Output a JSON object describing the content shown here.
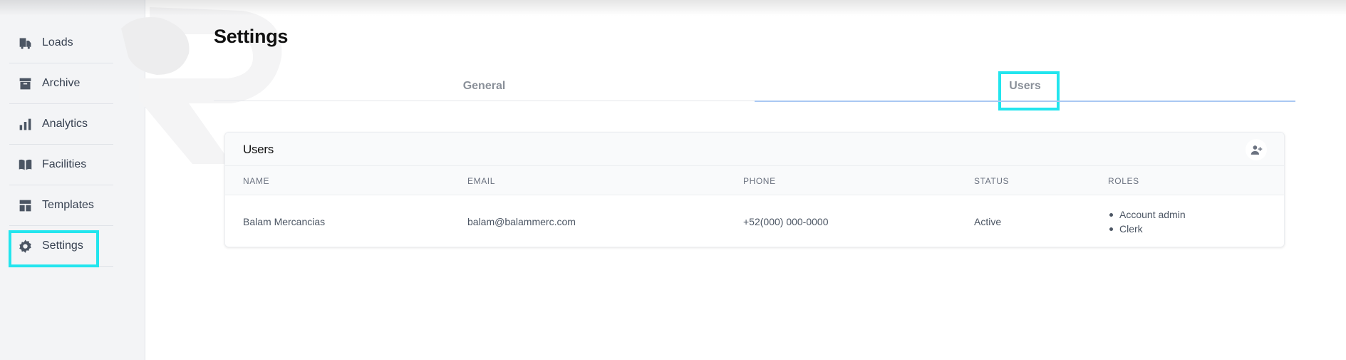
{
  "sidebar": {
    "items": [
      {
        "label": "Loads",
        "icon": "truck-icon"
      },
      {
        "label": "Archive",
        "icon": "archive-box-icon"
      },
      {
        "label": "Analytics",
        "icon": "bar-chart-icon"
      },
      {
        "label": "Facilities",
        "icon": "book-open-icon"
      },
      {
        "label": "Templates",
        "icon": "template-layout-icon"
      },
      {
        "label": "Settings",
        "icon": "gear-icon",
        "highlighted": true
      }
    ]
  },
  "page": {
    "title": "Settings"
  },
  "tabs": [
    {
      "label": "General",
      "active": false
    },
    {
      "label": "Users",
      "active": true
    }
  ],
  "users_card": {
    "title": "Users",
    "add_button_icon": "add-user-icon",
    "columns": [
      "Name",
      "Email",
      "Phone",
      "Status",
      "Roles"
    ],
    "rows": [
      {
        "name": "Balam Mercancias",
        "email": "balam@balammerc.com",
        "phone": "+52(000) 000-0000",
        "status": "Active",
        "roles": [
          "Account admin",
          "Clerk"
        ]
      }
    ]
  },
  "colors": {
    "highlight": "#22e5ee",
    "active_tab_underline": "#a9c8f3",
    "sidebar_bg": "#f3f4f6"
  }
}
